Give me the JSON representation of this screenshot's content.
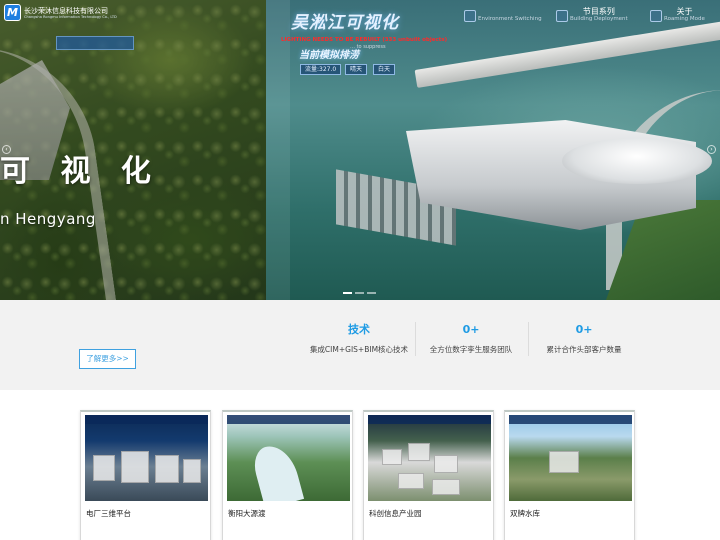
{
  "header": {
    "company_cn": "长沙荣沐信息科技有限公司",
    "company_en": "Changsha Rongmu Information Technology Co., LTD",
    "logo_letter": "M",
    "nav": [
      {
        "cn": "",
        "en": "Environment Switching"
      },
      {
        "cn": "节目系列",
        "en": "Building Deployment"
      },
      {
        "cn": "关于",
        "en": "Roaming Mode"
      }
    ]
  },
  "hero": {
    "left_slide": {
      "title": "可 视 化",
      "subtitle": "n Hengyang"
    },
    "right_slide": {
      "title": "吴淞江可视化",
      "warning": "LIGHTING NEEDS TO BE REBUILT (333 unbuilt objects)",
      "warning_sub": "… to suppress",
      "scene_title": "当前模拟排涝",
      "chips": [
        "流量:327.0",
        "晴天",
        "白天"
      ]
    },
    "arrows": {
      "prev": "‹",
      "next": "›"
    }
  },
  "intro": {
    "more_button": "了解更多>>",
    "stats": [
      {
        "number": "技术",
        "label": "集成CIM+GIS+BIM核心技术"
      },
      {
        "number": "0+",
        "label": "全方位数字孪生服务团队"
      },
      {
        "number": "0+",
        "label": "累计合作头部客户数量"
      }
    ]
  },
  "cases": [
    {
      "title": "电厂三维平台"
    },
    {
      "title": "衡阳大源渡"
    },
    {
      "title": "科创信息产业园"
    },
    {
      "title": "双牌水库"
    }
  ],
  "colors": {
    "accent_blue": "#1e9be4",
    "button_border": "#3fa1e0",
    "warning_red": "#ff2a2a",
    "nav_active": "#ffb400",
    "band_bg": "#f2f2f2"
  },
  "icons": [
    "logo-icon",
    "environment-icon",
    "building-icon",
    "roaming-icon",
    "prev-arrow-icon",
    "next-arrow-icon"
  ]
}
